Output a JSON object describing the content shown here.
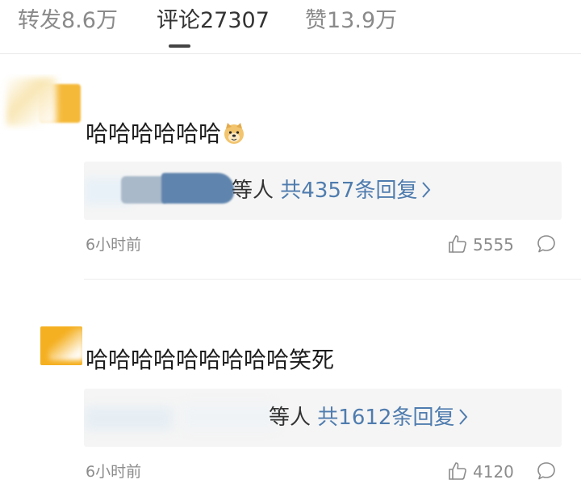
{
  "tabs": [
    {
      "label": "转发8.6万",
      "active": false
    },
    {
      "label": "评论27307",
      "active": true
    },
    {
      "label": "赞13.9万",
      "active": false
    }
  ],
  "comments": [
    {
      "text": "哈哈哈哈哈哈",
      "emoji": "doge",
      "reply_suffix": "等人",
      "reply_count_label": "共4357条回复",
      "time": "6小时前",
      "likes": "5555"
    },
    {
      "text": "哈哈哈哈哈哈哈哈哈笑死",
      "reply_suffix": "等人",
      "reply_count_label": "共1612条回复",
      "time": "6小时前",
      "likes": "4120"
    }
  ],
  "colors": {
    "link_blue": "#4f7cae",
    "muted_gray": "#8c8c8c",
    "avatar_orange": "#f5b93a"
  },
  "icons": [
    "doge-emoji-icon",
    "chevron-right-icon",
    "thumbs-up-icon",
    "comment-bubble-icon"
  ]
}
